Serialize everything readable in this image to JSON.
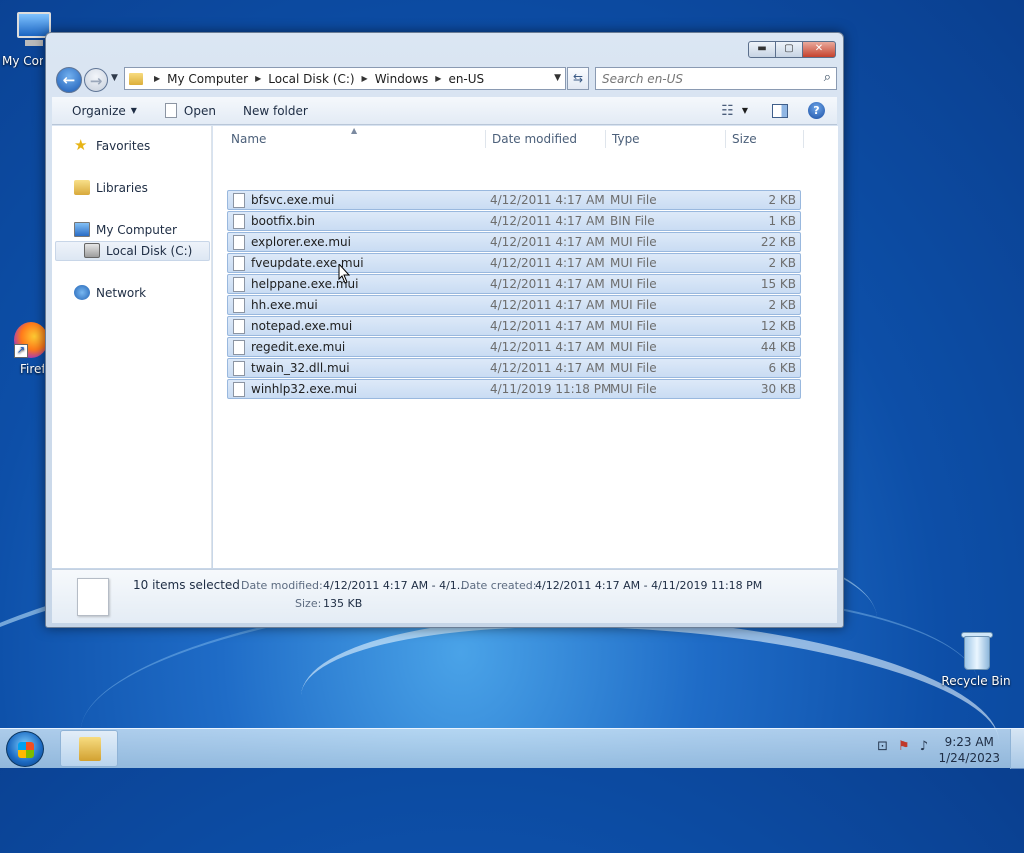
{
  "desktop": {
    "icons": [
      {
        "label": "My Computer",
        "icon": "my-computer-icon"
      },
      {
        "label": "Firefox",
        "icon": "firefox-icon"
      },
      {
        "label": "Recycle Bin",
        "icon": "recycle-bin-icon"
      }
    ]
  },
  "window": {
    "caption": {
      "minimize": "▬",
      "maximize": "▢",
      "close": "✕"
    },
    "address": {
      "crumbs": [
        "My Computer",
        "Local Disk (C:)",
        "Windows",
        "en-US"
      ],
      "refresh_glyph": "⇆"
    },
    "search": {
      "placeholder": "Search en-US"
    },
    "toolbar": {
      "organize": "Organize",
      "open": "Open",
      "new_folder": "New folder"
    },
    "nav": {
      "favorites": "Favorites",
      "libraries": "Libraries",
      "my_computer": "My Computer",
      "local_disk": "Local Disk (C:)",
      "network": "Network"
    },
    "columns": {
      "name": "Name",
      "date": "Date modified",
      "type": "Type",
      "size": "Size"
    },
    "files": [
      {
        "name": "bfsvc.exe.mui",
        "date": "4/12/2011 4:17 AM",
        "type": "MUI File",
        "size": "2 KB"
      },
      {
        "name": "bootfix.bin",
        "date": "4/12/2011 4:17 AM",
        "type": "BIN File",
        "size": "1 KB"
      },
      {
        "name": "explorer.exe.mui",
        "date": "4/12/2011 4:17 AM",
        "type": "MUI File",
        "size": "22 KB"
      },
      {
        "name": "fveupdate.exe.mui",
        "date": "4/12/2011 4:17 AM",
        "type": "MUI File",
        "size": "2 KB"
      },
      {
        "name": "helppane.exe.mui",
        "date": "4/12/2011 4:17 AM",
        "type": "MUI File",
        "size": "15 KB"
      },
      {
        "name": "hh.exe.mui",
        "date": "4/12/2011 4:17 AM",
        "type": "MUI File",
        "size": "2 KB"
      },
      {
        "name": "notepad.exe.mui",
        "date": "4/12/2011 4:17 AM",
        "type": "MUI File",
        "size": "12 KB"
      },
      {
        "name": "regedit.exe.mui",
        "date": "4/12/2011 4:17 AM",
        "type": "MUI File",
        "size": "44 KB"
      },
      {
        "name": "twain_32.dll.mui",
        "date": "4/12/2011 4:17 AM",
        "type": "MUI File",
        "size": "6 KB"
      },
      {
        "name": "winhlp32.exe.mui",
        "date": "4/11/2019 11:18 PM",
        "type": "MUI File",
        "size": "30 KB"
      }
    ],
    "details": {
      "selected": "10 items selected",
      "date_modified_label": "Date modified:",
      "date_modified_value": "4/12/2011 4:17 AM - 4/1...",
      "date_created_label": "Date created:",
      "date_created_value": "4/12/2011 4:17 AM - 4/11/2019 11:18 PM",
      "size_label": "Size:",
      "size_value": "135 KB"
    }
  },
  "taskbar": {
    "time": "9:23 AM",
    "date": "1/24/2023"
  }
}
